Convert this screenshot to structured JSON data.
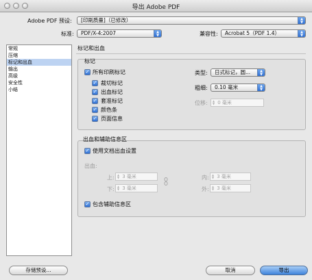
{
  "window": {
    "title": "导出 Adobe PDF"
  },
  "preset": {
    "label": "Adobe PDF 预设:",
    "value": "[印刷质量]（已修改）"
  },
  "standard": {
    "label": "标准:",
    "value": "PDF/X-4:2007"
  },
  "compatibility": {
    "label": "兼容性:",
    "value": "Acrobat 5（PDF 1.4）"
  },
  "sidebar": {
    "items": [
      {
        "label": "常规"
      },
      {
        "label": "压缩"
      },
      {
        "label": "标记和出血"
      },
      {
        "label": "输出"
      },
      {
        "label": "高级"
      },
      {
        "label": "安全性"
      },
      {
        "label": "小结"
      }
    ],
    "selected": "标记和出血"
  },
  "section_title": "标记和出血",
  "marks": {
    "group_title": "标记",
    "all_marks": "所有印刷标记",
    "items": [
      {
        "label": "裁切标记",
        "checked": true
      },
      {
        "label": "出血标记",
        "checked": true
      },
      {
        "label": "套准标记",
        "checked": true
      },
      {
        "label": "颜色条",
        "checked": true
      },
      {
        "label": "页面信息",
        "checked": true
      }
    ],
    "type_label": "类型:",
    "type_value": "日式标记，圆...",
    "weight_label": "粗细:",
    "weight_value": "0.10 毫米",
    "offset_label": "位移:",
    "offset_value": "0 毫米"
  },
  "bleed": {
    "group_title": "出血和辅助信息区",
    "use_doc": "使用文档出血设置",
    "bleed_label": "出血:",
    "top_label": "上:",
    "top_value": "3 毫米",
    "bottom_label": "下:",
    "bottom_value": "3 毫米",
    "inside_label": "内:",
    "inside_value": "3 毫米",
    "outside_label": "外:",
    "outside_value": "3 毫米",
    "include_slug": "包含辅助信息区"
  },
  "buttons": {
    "save_preset": "存储预设...",
    "cancel": "取消",
    "export": "导出"
  },
  "colors": {
    "accent": "#3e83db",
    "selection": "#bdd3f2"
  }
}
